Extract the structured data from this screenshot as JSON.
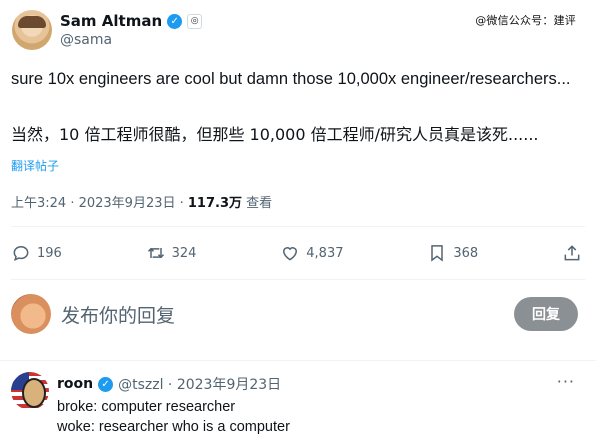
{
  "watermark": "@微信公众号：建评",
  "tweet": {
    "author_name": "Sam Altman",
    "author_handle": "@sama",
    "text": "sure 10x engineers are cool but damn those 10,000x engineer/researchers...",
    "translation": "当然，10 倍工程师很酷，但那些 10,000 倍工程师/研究人员真是该死......",
    "translate_link": "翻译帖子",
    "time": "上午3:24 · 2023年9月23日 · ",
    "views_count": "117.3万",
    "views_label": " 查看"
  },
  "actions": {
    "replies": "196",
    "retweets": "324",
    "likes": "4,837",
    "bookmarks": "368"
  },
  "reply_box": {
    "placeholder": "发布你的回复",
    "button": "回复"
  },
  "reply": {
    "name": "roon",
    "meta": "@tszzl · 2023年9月23日",
    "more": "···",
    "line1": "broke: computer researcher",
    "line2": "woke: researcher who is a computer"
  },
  "icons": {
    "verified": "verified-check-icon",
    "affiliate": "affiliate-badge-icon",
    "reply": "reply-icon",
    "retweet": "retweet-icon",
    "like": "heart-icon",
    "bookmark": "bookmark-icon",
    "share": "share-icon"
  },
  "colors": {
    "accent": "#1d9bf0",
    "muted": "#536471",
    "button": "#8b9095"
  }
}
